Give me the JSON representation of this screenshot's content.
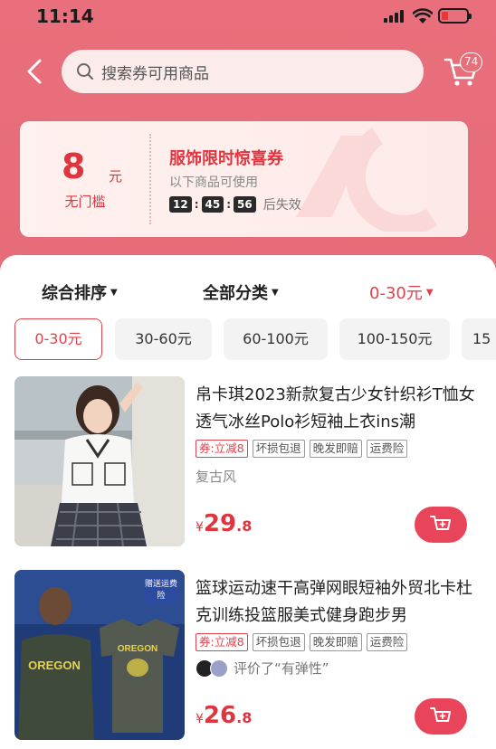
{
  "status_bar": {
    "time": "11:14"
  },
  "header": {
    "search_placeholder": "搜索券可用商品",
    "cart_count": "74"
  },
  "coupon": {
    "amount": "8",
    "unit": "元",
    "condition": "无门槛",
    "title": "服饰限时惊喜券",
    "subtitle": "以下商品可使用",
    "timer": [
      "12",
      "45",
      "56"
    ],
    "expire_text": "后失效"
  },
  "sort": {
    "items": [
      "综合排序",
      "全部分类",
      "0-30元"
    ],
    "active_index": 2
  },
  "price_filters": {
    "chips": [
      "0-30元",
      "30-60元",
      "60-100元",
      "100-150元",
      "15"
    ],
    "selected_index": 0
  },
  "products": [
    {
      "title": "帛卡琪2023新款复古少女针织衫T恤女透气冰丝Polo衫短袖上衣ins潮",
      "tags": [
        "券:立减8",
        "坏损包退",
        "晚发即赔",
        "运费险"
      ],
      "note": "复古风",
      "price_symbol": "¥",
      "price_int": "29",
      "price_dec": ".8"
    },
    {
      "title": "篮球运动速干高弹网眼短袖外贸北卡杜克训练投篮服美式健身跑步男",
      "tags": [
        "券:立减8",
        "坏损包退",
        "晚发即赔",
        "运费险"
      ],
      "review_text": "评价了“有弹性”",
      "promo_badge": "赠送运费险",
      "shirt_text": "OREGON",
      "price_symbol": "¥",
      "price_int": "26",
      "price_dec": ".8"
    }
  ],
  "colors": {
    "brand_red": "#e0343f",
    "header_bg": "#e6707a",
    "cart_button": "#e8445a"
  }
}
